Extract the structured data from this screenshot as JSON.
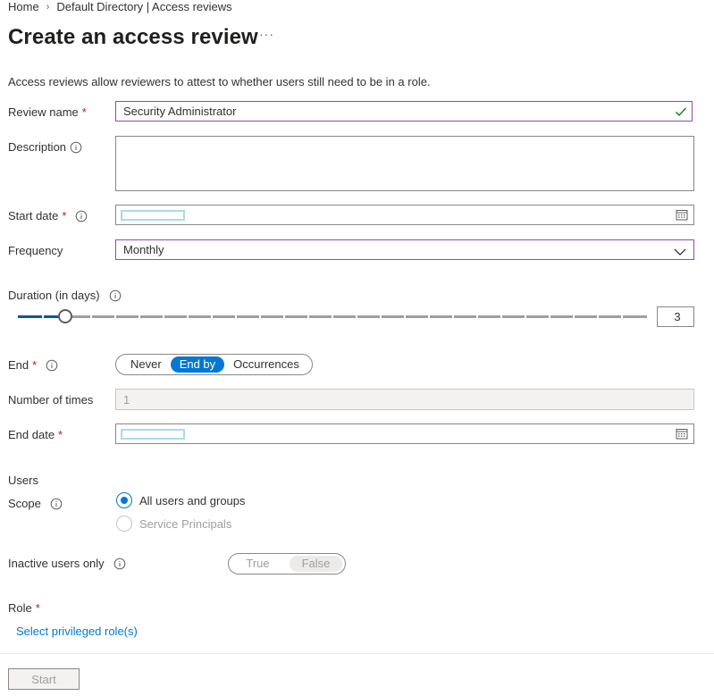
{
  "breadcrumb": {
    "home": "Home",
    "current": "Default Directory | Access reviews"
  },
  "page": {
    "title": "Create an access review",
    "more": "···",
    "description": "Access reviews allow reviewers to attest to whether users still need to be in a role."
  },
  "form": {
    "review_name": {
      "label": "Review name",
      "required": "*",
      "value": "Security Administrator"
    },
    "description": {
      "label": "Description",
      "value": ""
    },
    "start_date": {
      "label": "Start date",
      "required": "*"
    },
    "frequency": {
      "label": "Frequency",
      "value": "Monthly"
    },
    "duration": {
      "label": "Duration (in days)",
      "value": "3",
      "slider_fraction": 0.07
    },
    "end": {
      "label": "End",
      "required": "*",
      "options": [
        "Never",
        "End by",
        "Occurrences"
      ],
      "selected": "End by"
    },
    "number_of_times": {
      "label": "Number of times",
      "value": "1"
    },
    "end_date": {
      "label": "End date",
      "required": "*"
    },
    "users": {
      "heading": "Users"
    },
    "scope": {
      "label": "Scope",
      "options": [
        {
          "label": "All users and groups",
          "selected": true,
          "enabled": true
        },
        {
          "label": "Service Principals",
          "selected": false,
          "enabled": false
        }
      ]
    },
    "inactive": {
      "label": "Inactive users only",
      "options": [
        "True",
        "False"
      ],
      "selected": "False"
    },
    "role": {
      "label": "Role",
      "required": "*",
      "link": "Select privileged role(s)"
    }
  },
  "footer": {
    "start_label": "Start"
  },
  "colors": {
    "accent": "#0078d4",
    "required": "#a4262c",
    "focus_border": "#8f4bb2",
    "success": "#107c10"
  },
  "icons": [
    "info-icon",
    "calendar-icon",
    "checkmark-icon",
    "chevron-down-icon",
    "breadcrumb-chevron-icon",
    "more-icon"
  ]
}
